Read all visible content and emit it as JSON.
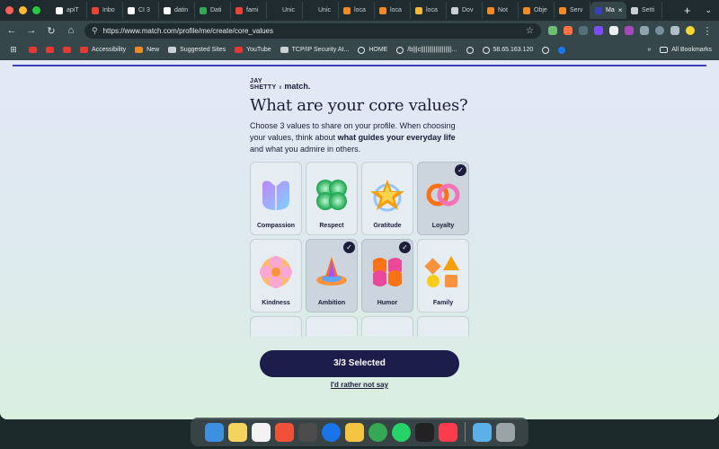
{
  "browser": {
    "tabs": [
      {
        "label": "apiT",
        "icon": "github-icon",
        "color": "#ffffff"
      },
      {
        "label": "Inbo",
        "icon": "gmail-icon",
        "color": "#ea4335"
      },
      {
        "label": "CI 3",
        "icon": "github-icon",
        "color": "#ffffff"
      },
      {
        "label": "datin",
        "icon": "github-icon",
        "color": "#ffffff"
      },
      {
        "label": "Dati",
        "icon": "sheets-icon",
        "color": "#34a853"
      },
      {
        "label": "fami",
        "icon": "gmail-icon",
        "color": "#ea4335"
      },
      {
        "label": "Unic",
        "icon": "blank-icon",
        "color": "#1f2b2e"
      },
      {
        "label": "Unic",
        "icon": "blank-icon",
        "color": "#1f2b2e"
      },
      {
        "label": "loca",
        "icon": "localhost-icon",
        "color": "#f08a24"
      },
      {
        "label": "loca",
        "icon": "localhost-icon",
        "color": "#f08a24"
      },
      {
        "label": "loca",
        "icon": "chart-icon",
        "color": "#f6b93b"
      },
      {
        "label": "Dov",
        "icon": "download-icon",
        "color": "#c9d1d3"
      },
      {
        "label": "Not",
        "icon": "localhost-icon",
        "color": "#f08a24"
      },
      {
        "label": "Obje",
        "icon": "localhost-icon",
        "color": "#f08a24"
      },
      {
        "label": "Serv",
        "icon": "localhost-icon",
        "color": "#f08a24"
      },
      {
        "label": "Ma",
        "icon": "match-icon",
        "color": "#3b3fb8",
        "active": true
      },
      {
        "label": "Setti",
        "icon": "gear-icon",
        "color": "#c9d1d3"
      }
    ],
    "new_tab": "+",
    "address": {
      "url": "https://www.match.com/profile/me/create/core_values"
    },
    "bookmarks": [
      {
        "label": "",
        "icon": "youtube-icon",
        "color": "#e53935"
      },
      {
        "label": "",
        "icon": "youtube-icon",
        "color": "#e53935"
      },
      {
        "label": "",
        "icon": "youtube-icon",
        "color": "#e53935"
      },
      {
        "label": "Accessibility",
        "icon": "adobe-icon",
        "color": "#e53935"
      },
      {
        "label": "New",
        "icon": "tag-icon",
        "color": "#f08a24"
      },
      {
        "label": "Suggested Sites",
        "icon": "search-icon",
        "color": "#c9d1d3"
      },
      {
        "label": "YouTube",
        "icon": "youtube-icon",
        "color": "#e53935"
      },
      {
        "label": "TCP/IP Security At...",
        "icon": "doc-icon",
        "color": "#c9d1d3"
      },
      {
        "label": "HOME",
        "icon": "globe-icon",
        "color": "#e8eced"
      },
      {
        "label": "/b|||c|||||||||||||||||||...",
        "icon": "globe-icon",
        "color": "#e8eced"
      },
      {
        "label": "",
        "icon": "globe-icon",
        "color": "#e8eced"
      },
      {
        "label": "58.65.163.120",
        "icon": "globe-icon",
        "color": "#e8eced"
      },
      {
        "label": "",
        "icon": "globe-icon",
        "color": "#e8eced"
      },
      {
        "label": "",
        "icon": "facebook-icon",
        "color": "#1877f2"
      }
    ],
    "bookmarks_overflow": "»",
    "all_bookmarks": "All Bookmarks"
  },
  "page": {
    "brand": {
      "line1": "JAY",
      "line2": "SHETTY",
      "x": "x",
      "match": "match."
    },
    "title": "What are your core values?",
    "desc_part1": "Choose 3 values to share on your profile. When choosing your values, think about ",
    "desc_bold": "what guides your everyday life",
    "desc_part2": " and what you admire in others.",
    "values": [
      {
        "label": "Compassion",
        "selected": false
      },
      {
        "label": "Respect",
        "selected": false
      },
      {
        "label": "Gratitude",
        "selected": false
      },
      {
        "label": "Loyalty",
        "selected": true
      },
      {
        "label": "Kindness",
        "selected": false
      },
      {
        "label": "Ambition",
        "selected": true
      },
      {
        "label": "Humor",
        "selected": true
      },
      {
        "label": "Family",
        "selected": false
      }
    ],
    "check_glyph": "✓",
    "cta": "3/3 Selected",
    "skip": "I'd rather not say"
  },
  "colors": {
    "accent": "#1c1d4a",
    "progress": "#3b3fb8"
  },
  "dock": [
    {
      "name": "finder-icon",
      "color": "#3d8fe0"
    },
    {
      "name": "notes-icon",
      "color": "#f4d35e"
    },
    {
      "name": "reminders-icon",
      "color": "#f2f2f2"
    },
    {
      "name": "swift-icon",
      "color": "#f05138"
    },
    {
      "name": "sublime-icon",
      "color": "#4b4b4b"
    },
    {
      "name": "maps-pin-icon",
      "color": "#1a73e8"
    },
    {
      "name": "cyberduck-icon",
      "color": "#f5c542"
    },
    {
      "name": "chrome-icon",
      "color": "#34a853"
    },
    {
      "name": "whatsapp-icon",
      "color": "#25d366"
    },
    {
      "name": "terminal-icon",
      "color": "#222222"
    },
    {
      "name": "music-icon",
      "color": "#fa3c4c"
    },
    {
      "name": "folder-icon",
      "color": "#5ab0e8"
    },
    {
      "name": "trash-icon",
      "color": "#9aa3a6"
    }
  ]
}
